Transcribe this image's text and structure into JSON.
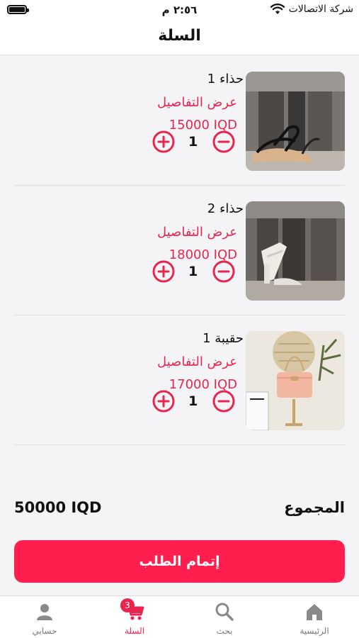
{
  "status_bar": {
    "carrier": "شركة الاتصالات",
    "time": "٢:٥٦ م"
  },
  "header": {
    "title": "السلة"
  },
  "cart": {
    "details_label": "عرض التفاصيل",
    "items": [
      {
        "name": "حذاء 1",
        "price": "15000 IQD",
        "quantity": "1"
      },
      {
        "name": "حذاء 2",
        "price": "18000 IQD",
        "quantity": "1"
      },
      {
        "name": "حقيبة 1",
        "price": "17000 IQD",
        "quantity": "1"
      }
    ]
  },
  "summary": {
    "total_label": "المجموع",
    "total_value": "50000 IQD"
  },
  "checkout": {
    "label": "إتمام الطلب"
  },
  "tabbar": {
    "tabs": [
      {
        "label": "الرئيسية",
        "icon": "home-icon"
      },
      {
        "label": "بحث",
        "icon": "search-icon"
      },
      {
        "label": "السلة",
        "icon": "cart-icon",
        "badge": "3",
        "active": true
      },
      {
        "label": "حسابي",
        "icon": "user-icon"
      }
    ]
  },
  "colors": {
    "accent": "#e8254f",
    "button": "#ff1e4e",
    "background": "#f4f4f6",
    "inactive_tab": "#7a7a7a"
  }
}
